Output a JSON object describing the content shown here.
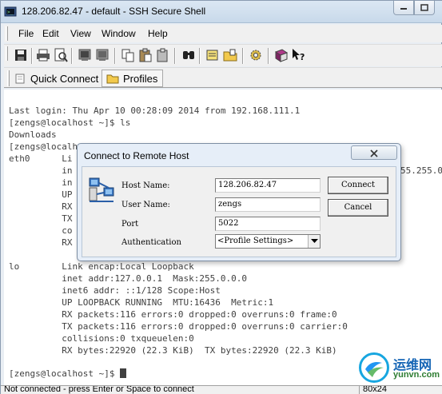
{
  "window": {
    "title": "128.206.82.47 - default - SSH Secure Shell"
  },
  "menu": [
    "File",
    "Edit",
    "View",
    "Window",
    "Help"
  ],
  "toolbar": {
    "icons": [
      "save-icon",
      "print-icon",
      "print-preview-icon",
      "new-terminal-icon",
      "new-file-transfer-icon",
      "copy-icon",
      "paste-icon",
      "paste-special-icon",
      "find-icon",
      "settings-icon",
      "folder-profile-icon",
      "gear-icon",
      "help-book-icon",
      "whats-this-icon"
    ]
  },
  "quickbar": {
    "quick_connect": "Quick Connect",
    "profiles": "Profiles"
  },
  "terminal": {
    "lines": [
      "Last login: Thu Apr 10 00:28:09 2014 from 192.168.111.1",
      "[zengs@localhost ~]$ ls",
      "Downloads",
      "[zengs@localhost ~]$ ifconfig",
      "eth0      Li",
      "          in",
      "          in",
      "          UP",
      "          RX",
      "          TX",
      "          co",
      "          RX",
      "",
      "lo        Link encap:Local Loopback",
      "          inet addr:127.0.0.1  Mask:255.0.0.0",
      "          inet6 addr: ::1/128 Scope:Host",
      "          UP LOOPBACK RUNNING  MTU:16436  Metric:1",
      "          RX packets:116 errors:0 dropped:0 overruns:0 frame:0",
      "          TX packets:116 errors:0 dropped:0 overruns:0 carrier:0",
      "          collisions:0 txqueuelen:0",
      "          RX bytes:22920 (22.3 KiB)  TX bytes:22920 (22.3 KiB)",
      "",
      "[zengs@localhost ~]$ "
    ],
    "eth0_fragment": "55.255.0"
  },
  "status": {
    "text": "Not connected - press Enter or Space to connect",
    "size": "80x24"
  },
  "dialog": {
    "title": "Connect to Remote Host",
    "host_label": "Host Name:",
    "host_value": "128.206.82.47",
    "user_label": "User Name:",
    "user_value": "zengs",
    "port_label": "Port",
    "port_value": "5022",
    "auth_label": "Authentication",
    "auth_value": "<Profile Settings>",
    "connect_label": "Connect",
    "cancel_label": "Cancel"
  },
  "watermark": {
    "cn": "运维网",
    "url": "yunvn.com"
  }
}
